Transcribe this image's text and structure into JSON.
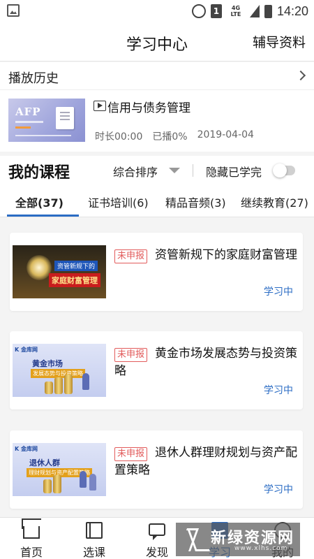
{
  "status_bar": {
    "network": "4G LTE",
    "sim": "1",
    "time": "14:20"
  },
  "header": {
    "title": "学习中心",
    "action": "辅导资料"
  },
  "history": {
    "label": "播放历史",
    "thumb_text": "AFP",
    "title": "信用与债务管理",
    "duration": "时长00:00",
    "played": "已播0%",
    "date": "2019-04-04"
  },
  "courses": {
    "title": "我的课程",
    "sort_label": "综合排序",
    "hide_label": "隐藏已学完",
    "hide_completed": false
  },
  "tabs": [
    {
      "label": "全部(37)",
      "active": true
    },
    {
      "label": "证书培训(6)",
      "active": false
    },
    {
      "label": "精品音频(3)",
      "active": false
    },
    {
      "label": "继续教育(27)",
      "active": false
    }
  ],
  "cards": [
    {
      "tag": "未申报",
      "title": "资管新规下的家庭财富管理",
      "status": "学习中",
      "thumb_l1": "资管新规下的",
      "thumb_l2": "家庭财富管理"
    },
    {
      "tag": "未申报",
      "title": "黄金市场发展态势与投资策略",
      "status": "学习中",
      "thumb_logo": "K 金库网",
      "thumb_l1": "黄金市场",
      "thumb_l2": "发展态势与投资策略"
    },
    {
      "tag": "未申报",
      "title": "退休人群理财规划与资产配置策略",
      "status": "学习中",
      "thumb_logo": "K 金库网",
      "thumb_l1": "退休人群",
      "thumb_l2": "理财规划与资产配置策略"
    }
  ],
  "bottom_nav": [
    {
      "label": "首页",
      "icon": "home-icon",
      "active": false
    },
    {
      "label": "选课",
      "icon": "book-icon",
      "active": false
    },
    {
      "label": "发现",
      "icon": "chat-icon",
      "active": false
    },
    {
      "label": "学习",
      "icon": "study-icon",
      "active": true
    },
    {
      "label": "我的",
      "icon": "profile-icon",
      "active": false
    }
  ],
  "watermark": {
    "text": "新绿资源网",
    "url": "www.xlhs.com"
  },
  "colors": {
    "accent": "#2b6cc4",
    "tag": "#e25b5b"
  }
}
